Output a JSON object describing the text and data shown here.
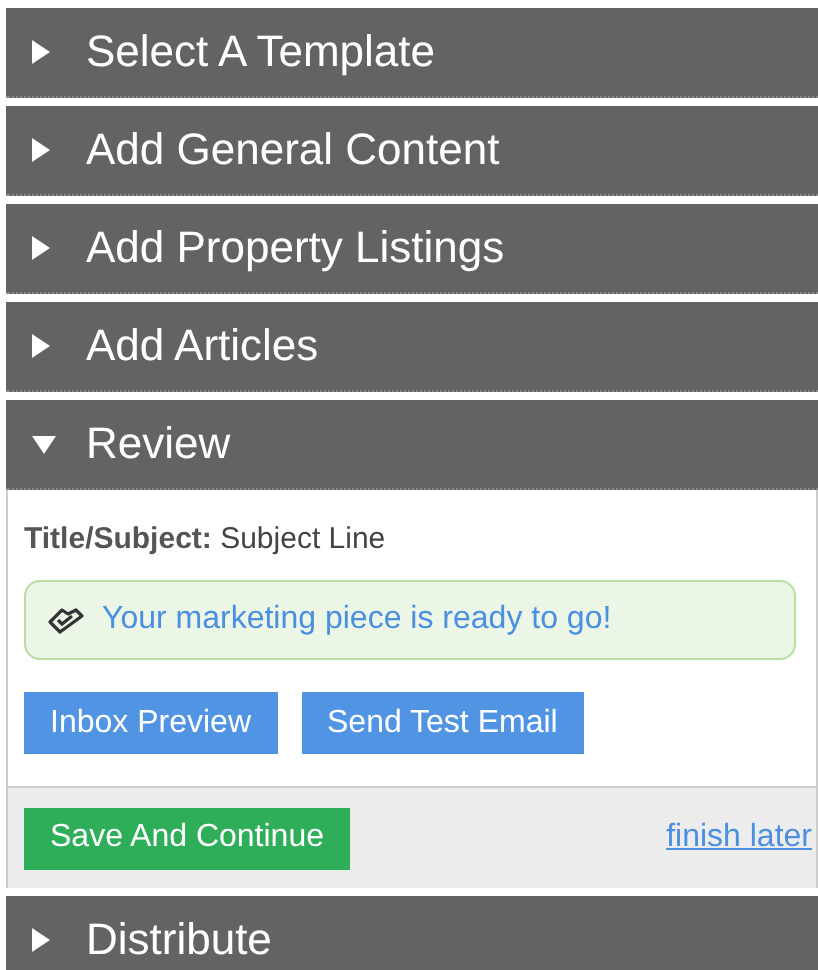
{
  "sections": [
    {
      "title": "Select A Template",
      "expanded": false
    },
    {
      "title": "Add General Content",
      "expanded": false
    },
    {
      "title": "Add Property Listings",
      "expanded": false
    },
    {
      "title": "Add Articles",
      "expanded": false
    },
    {
      "title": "Review",
      "expanded": true,
      "content": {
        "subject_label": "Title/Subject:",
        "subject_value": "Subject Line",
        "alert": "Your marketing piece is ready to go!",
        "buttons": [
          "Inbox Preview",
          "Send Test Email"
        ],
        "save_button": "Save And Continue",
        "finish_link": "finish later"
      }
    },
    {
      "title": "Distribute",
      "expanded": false
    }
  ]
}
